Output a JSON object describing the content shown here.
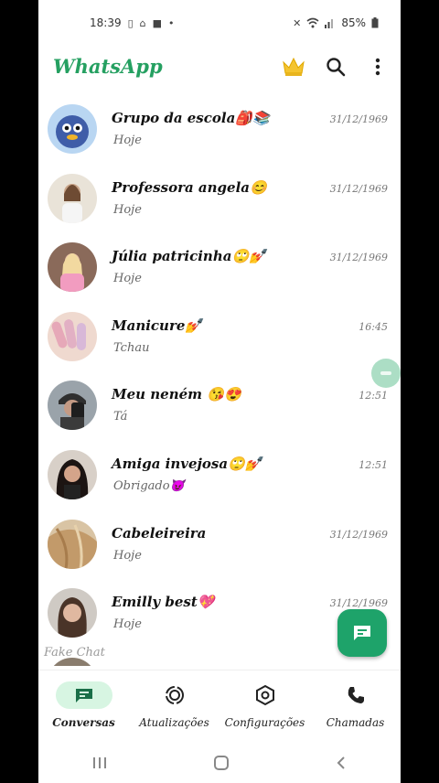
{
  "status_bar": {
    "time": "18:39",
    "battery": "85%"
  },
  "app": {
    "title": "WhatsApp"
  },
  "chats": [
    {
      "name": "Grupo da escola🎒📚",
      "message": "Hoje",
      "time": "31/12/1969",
      "avatar_color": "#3f5da8"
    },
    {
      "name": "Professora angela😊",
      "message": "Hoje",
      "time": "31/12/1969",
      "avatar_color": "#b8a48a"
    },
    {
      "name": "Júlia patricinha🙄💅",
      "message": "Hoje",
      "time": "31/12/1969",
      "avatar_color": "#d49aa6"
    },
    {
      "name": "Manicure💅",
      "message": "Tchau",
      "time": "16:45",
      "avatar_color": "#e5c2b6"
    },
    {
      "name": "Meu neném 😘😍",
      "message": "Tá",
      "time": "12:51",
      "avatar_color": "#5a5a5a"
    },
    {
      "name": "Amiga invejosa🙄💅",
      "message": "Obrigado😈",
      "time": "12:51",
      "avatar_color": "#3a2622"
    },
    {
      "name": "Cabeleireira",
      "message": "Hoje",
      "time": "31/12/1969",
      "avatar_color": "#c9a77c"
    },
    {
      "name": "Emilly best💖",
      "message": "Hoje",
      "time": "31/12/1969",
      "avatar_color": "#6b5444"
    },
    {
      "name": "",
      "message": "",
      "time": "",
      "avatar_color": "#8a7d6e"
    }
  ],
  "watermark": "Fake Chat",
  "bottom_nav": [
    {
      "label": "Conversas",
      "icon": "chat-icon",
      "active": true
    },
    {
      "label": "Atualizações",
      "icon": "status-icon",
      "active": false
    },
    {
      "label": "Configurações",
      "icon": "settings-icon",
      "active": false
    },
    {
      "label": "Chamadas",
      "icon": "phone-icon",
      "active": false
    }
  ],
  "colors": {
    "brand": "#25a061",
    "fab": "#1ea36a",
    "active_nav": "#d7f5e2"
  }
}
